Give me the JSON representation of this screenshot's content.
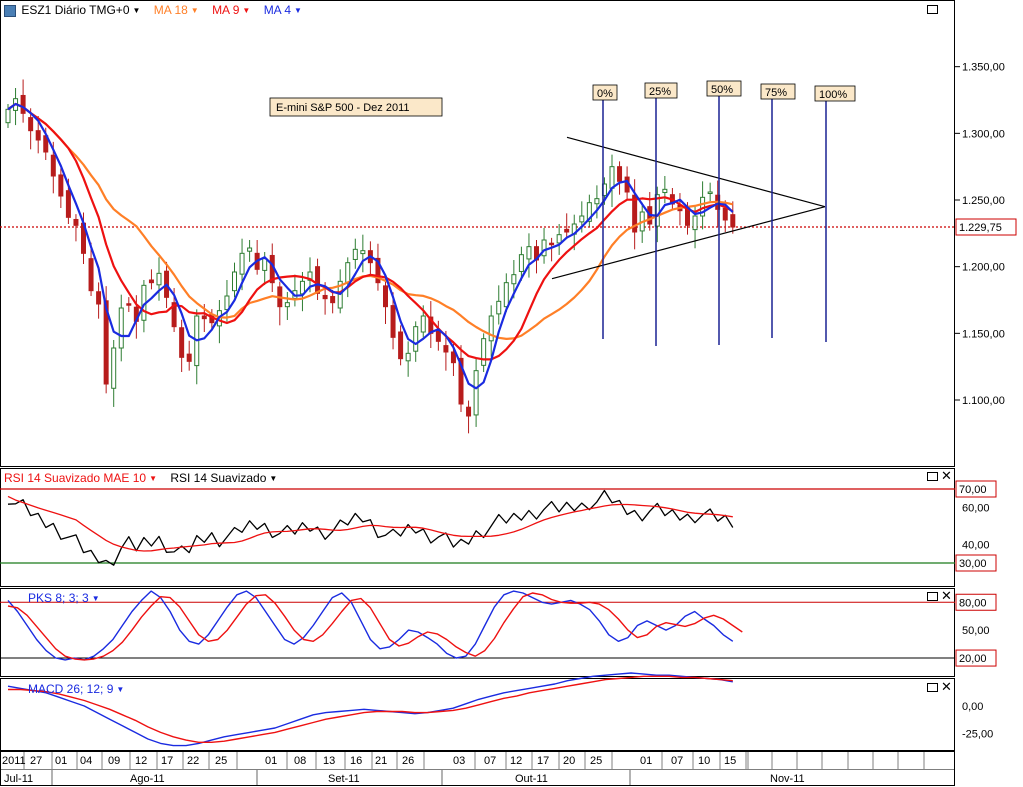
{
  "header": {
    "symbol": "ESZ1 Diário TMG+0",
    "ma18": "MA 18",
    "ma9": "MA 9",
    "ma4": "MA 4"
  },
  "annotations": {
    "title_box": "E-mini S&P 500 - Dez 2011",
    "fib_labels": [
      "0%",
      "25%",
      "50%",
      "75%",
      "100%"
    ]
  },
  "panels": {
    "rsi_label_1": "RSI 14 Suavizado MAE 10",
    "rsi_label_2": "RSI 14 Suavizado",
    "pks_label": "PKS 8; 3; 3",
    "macd_label": "MACD 26; 12; 9"
  },
  "colors": {
    "ma18": "#ff7f27",
    "ma9": "#ee1111",
    "ma4": "#1a2be0",
    "bull": "#2e7d32",
    "bear": "#b71c1c",
    "last_price_line": "#cc0000"
  },
  "chart_data": {
    "type": "candlestick",
    "instrument": "E-mini S&P 500 - Dez 2011",
    "price_axis": {
      "ticks": [
        "1.350,00",
        "1.300,00",
        "1.250,00",
        "1.200,00",
        "1.150,00",
        "1.100,00"
      ],
      "tick_values": [
        1350,
        1300,
        1250,
        1200,
        1150,
        1100
      ],
      "last_price": "1.229,75",
      "last_value": 1229.75
    },
    "rsi_axis": {
      "ticks": [
        "70,00",
        "60,00",
        "40,00",
        "30,00"
      ],
      "levels": [
        70,
        30
      ],
      "tick_values": [
        60,
        40
      ]
    },
    "pks_axis": {
      "ticks": [
        "80,00",
        "50,00",
        "20,00"
      ],
      "values": [
        80,
        50,
        20
      ]
    },
    "macd_axis": {
      "ticks": [
        "0,00",
        "-25,00"
      ],
      "values": [
        0,
        -25
      ]
    },
    "x_day_labels": [
      "2011",
      "27",
      "01",
      "04",
      "09",
      "12",
      "17",
      "22",
      "25",
      "01",
      "08",
      "13",
      "16",
      "21",
      "26",
      "03",
      "07",
      "12",
      "17",
      "20",
      "25",
      "01",
      "07",
      "10",
      "15"
    ],
    "x_month_labels": [
      "Jul-11",
      "Ago-11",
      "Set-11",
      "Out-11",
      "Nov-11"
    ],
    "closes": [
      1318,
      1326,
      1315,
      1302,
      1295,
      1286,
      1268,
      1253,
      1237,
      1231,
      1210,
      1182,
      1172,
      1112,
      1139,
      1169,
      1172,
      1159,
      1186,
      1188,
      1195,
      1177,
      1155,
      1132,
      1129,
      1163,
      1161,
      1158,
      1167,
      1178,
      1196,
      1210,
      1214,
      1198,
      1206,
      1188,
      1170,
      1173,
      1182,
      1189,
      1196,
      1180,
      1176,
      1173,
      1189,
      1203,
      1213,
      1212,
      1203,
      1188,
      1170,
      1147,
      1131,
      1135,
      1155,
      1163,
      1150,
      1144,
      1136,
      1128,
      1097,
      1088,
      1122,
      1146,
      1163,
      1174,
      1188,
      1194,
      1209,
      1215,
      1205,
      1220,
      1217,
      1224,
      1226,
      1232,
      1238,
      1248,
      1251,
      1262,
      1275,
      1264,
      1256,
      1226,
      1241,
      1232,
      1254,
      1258,
      1247,
      1242,
      1231,
      1238,
      1252,
      1256,
      1243,
      1235,
      1229.75
    ],
    "ma18_note": "orange moving average",
    "ma9_note": "red moving average",
    "ma4_note": "blue moving average",
    "rsi_smoothed": [
      66,
      62,
      60,
      57,
      54,
      52,
      50,
      47,
      44,
      41,
      37,
      34,
      33,
      30,
      33,
      38,
      40,
      38,
      41,
      42,
      43,
      40,
      36,
      35,
      37,
      42,
      44,
      45,
      43,
      44,
      45,
      48,
      50,
      51,
      50,
      48,
      46,
      46,
      47,
      49,
      50,
      48,
      47,
      47,
      49,
      52,
      54,
      55,
      52,
      48,
      45,
      44,
      46,
      48,
      49,
      47,
      45,
      44,
      42,
      40,
      40,
      43,
      46,
      48,
      50,
      52,
      53,
      54,
      56,
      57,
      58,
      59,
      59,
      59,
      60,
      61,
      61,
      63,
      63,
      65,
      64,
      61,
      59,
      57,
      57,
      58,
      58,
      57,
      56,
      56,
      55,
      56,
      56,
      55,
      54,
      53,
      52
    ],
    "pks": {
      "blue": [
        82,
        70,
        55,
        40,
        28,
        20,
        18,
        20,
        18,
        22,
        30,
        40,
        55,
        70,
        82,
        92,
        85,
        70,
        50,
        38,
        35,
        45,
        60,
        75,
        88,
        92,
        85,
        70,
        55,
        40,
        35,
        42,
        55,
        70,
        85,
        90,
        80,
        60,
        40,
        30,
        32,
        40,
        50,
        48,
        42,
        35,
        25,
        20,
        22,
        35,
        55,
        75,
        88,
        92,
        90,
        85,
        80,
        78,
        80,
        82,
        78,
        72,
        60,
        45,
        38,
        42,
        55,
        60,
        55,
        50,
        55,
        65,
        70,
        62,
        55,
        45,
        38
      ],
      "red": [
        76,
        74,
        66,
        54,
        42,
        30,
        22,
        19,
        18,
        19,
        22,
        28,
        37,
        50,
        64,
        76,
        86,
        85,
        75,
        60,
        45,
        38,
        40,
        50,
        64,
        78,
        87,
        88,
        79,
        65,
        50,
        40,
        38,
        45,
        57,
        70,
        82,
        84,
        74,
        57,
        40,
        33,
        36,
        43,
        48,
        46,
        40,
        32,
        26,
        22,
        28,
        41,
        58,
        73,
        86,
        90,
        88,
        83,
        80,
        79,
        79,
        80,
        78,
        72,
        62,
        50,
        42,
        45,
        54,
        58,
        56,
        54,
        57,
        63,
        66,
        62,
        55,
        48
      ]
    },
    "macd": {
      "line": [
        18,
        16,
        14,
        12,
        8,
        4,
        0,
        -6,
        -12,
        -18,
        -24,
        -30,
        -34,
        -36,
        -36,
        -34,
        -31,
        -28,
        -26,
        -24,
        -22,
        -20,
        -16,
        -12,
        -8,
        -6,
        -5,
        -4,
        -3,
        -4,
        -5,
        -6,
        -7,
        -6,
        -4,
        -2,
        2,
        6,
        9,
        12,
        14,
        16,
        18,
        20,
        23,
        25,
        27,
        28,
        29,
        30,
        29,
        28,
        28,
        27,
        26,
        25,
        24,
        22
      ],
      "signal": [
        15,
        15,
        14,
        13,
        11,
        8,
        5,
        1,
        -3,
        -8,
        -13,
        -19,
        -24,
        -28,
        -31,
        -33,
        -33,
        -32,
        -30,
        -28,
        -26,
        -24,
        -21,
        -18,
        -15,
        -12,
        -10,
        -8,
        -6,
        -5,
        -5,
        -5,
        -6,
        -6,
        -5,
        -4,
        -2,
        1,
        4,
        7,
        9,
        12,
        14,
        16,
        18,
        20,
        22,
        24,
        25,
        26,
        27,
        27,
        27,
        26,
        26,
        25,
        24,
        23
      ]
    }
  }
}
